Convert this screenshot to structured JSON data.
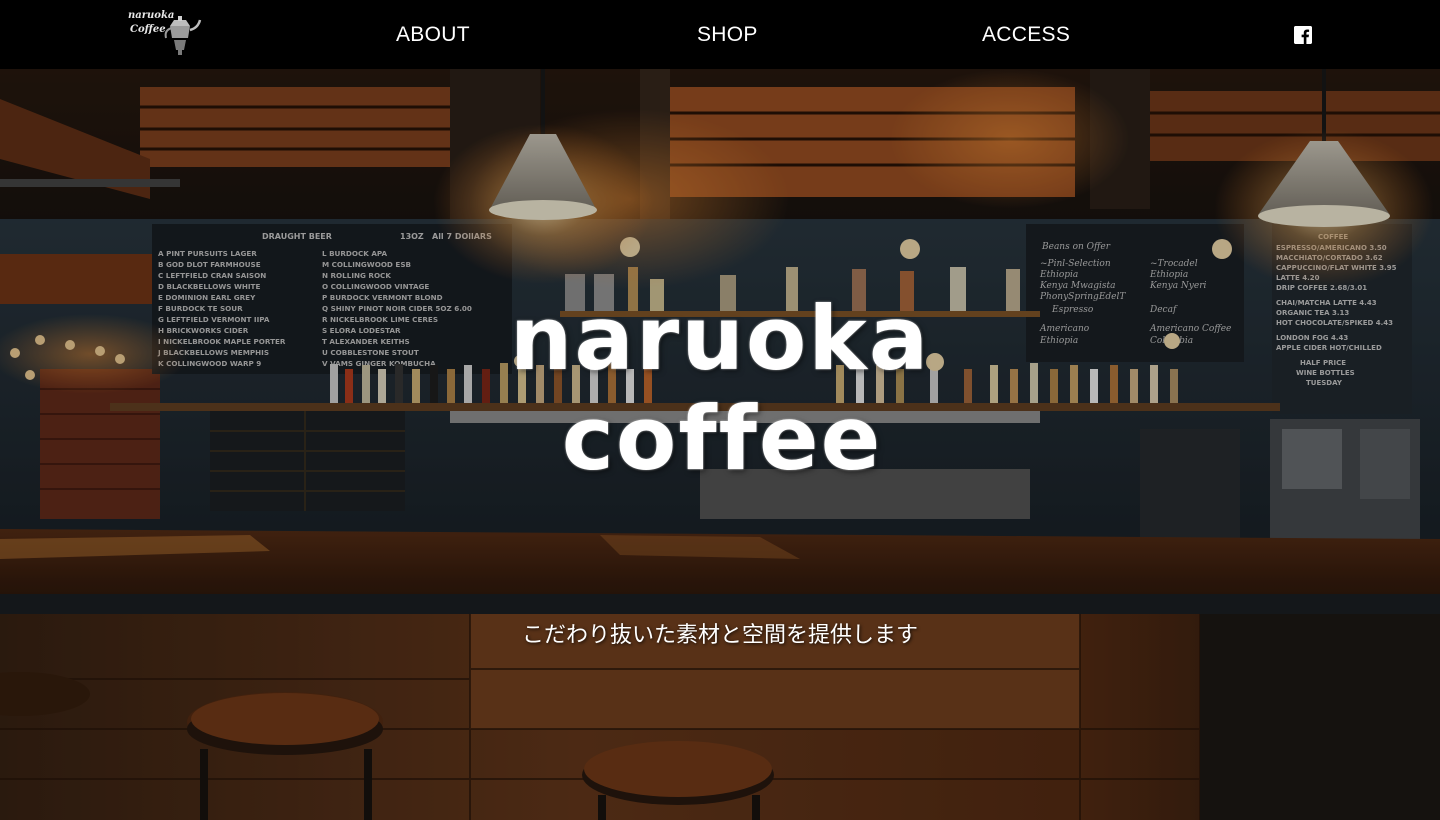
{
  "header": {
    "logo": {
      "line1": "naruoka",
      "line2": "Coffee"
    },
    "nav": [
      {
        "label": "ABOUT"
      },
      {
        "label": "SHOP"
      },
      {
        "label": "ACCESS"
      }
    ],
    "social": {
      "icon": "facebook-icon"
    }
  },
  "hero": {
    "title_line1": "naruoka",
    "title_line2": "coffee",
    "tagline": "こだわり抜いた素材と空間を提供します"
  },
  "colors": {
    "header_bg": "#000000",
    "text": "#ffffff",
    "wood": "#6a3a1c",
    "warm_light": "#ffb45a",
    "chalkboard": "#27343f"
  }
}
